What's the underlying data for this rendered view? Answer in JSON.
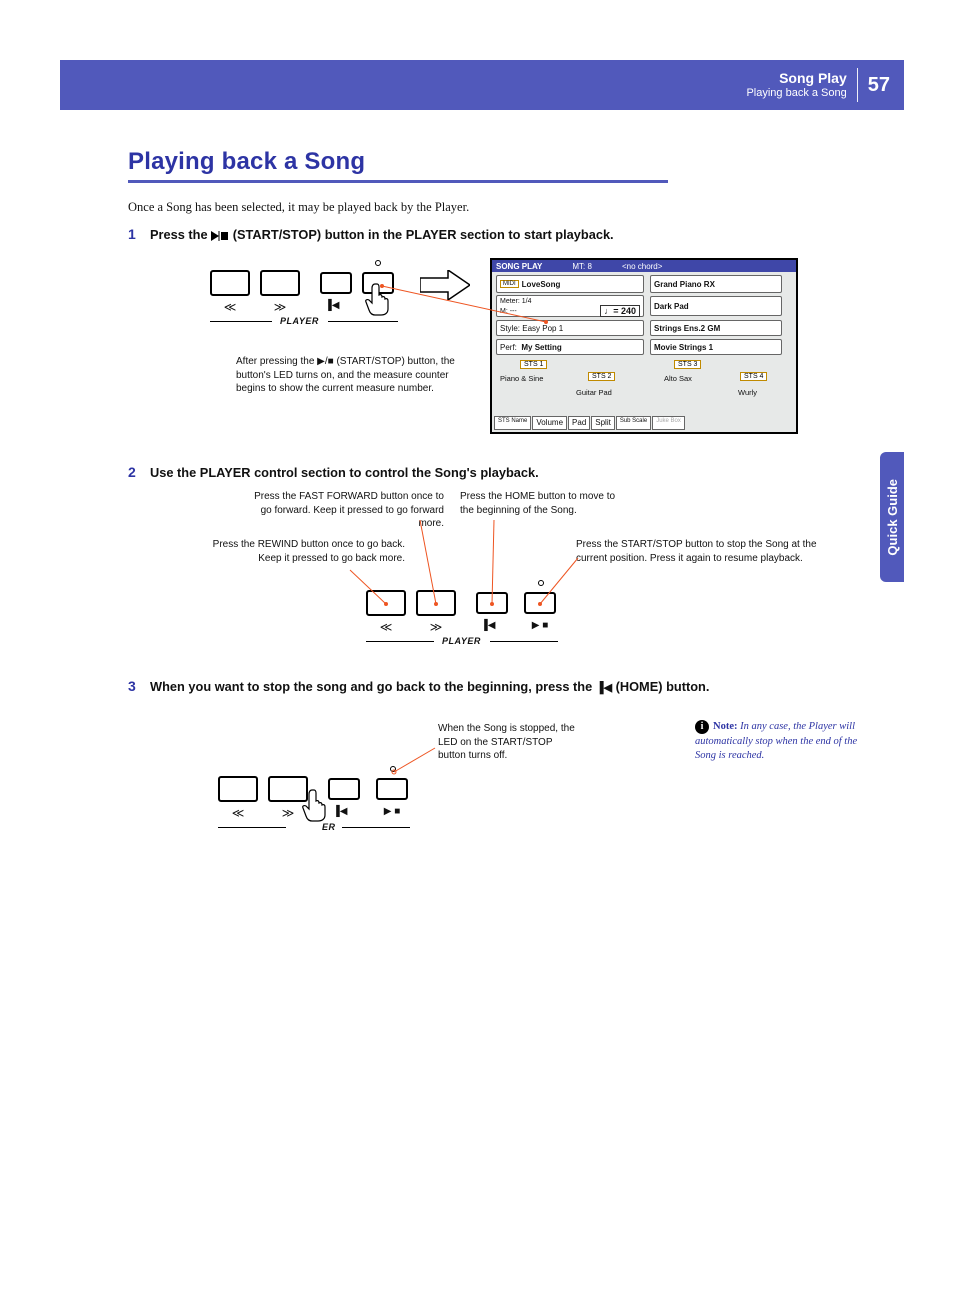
{
  "header": {
    "section": "Song Play",
    "subsection": "Playing back a Song",
    "page": "57"
  },
  "sidetab": "Quick Guide",
  "title": "Playing back a Song",
  "intro": "Once a Song has been selected, it may be played back by the Player.",
  "steps": {
    "s1": {
      "num": "1",
      "text_a": "Press the ",
      "text_b": " (START/STOP) button in the PLAYER section to start playback."
    },
    "s2": {
      "num": "2",
      "text": "Use the PLAYER control section to control the Song's playback."
    },
    "s3": {
      "num": "3",
      "text_a": "When you want to stop the song and go back to the beginning, press the ",
      "text_b": " (HOME) button."
    }
  },
  "captions": {
    "c1": "After pressing the ▶/■ (START/STOP) button, the button's LED turns on, and the measure counter begins to show the current measure number.",
    "ff": "Press the FAST FORWARD button once to go forward. Keep it pressed to go forward more.",
    "home": "Press the HOME button to move to the beginning of the Song.",
    "rew": "Press the REWIND button once to go back. Keep it pressed to go back more.",
    "ss": "Press the START/STOP button to stop the Song at the current position. Press it again to resume playback.",
    "ledoff": "When the Song is stopped, the LED on the START/STOP button turns off."
  },
  "player_label": "PLAYER",
  "symbols": {
    "rew": "≪",
    "ff": "≫",
    "home": "▐◀",
    "playstop": "▶ ■"
  },
  "lcd": {
    "title": "SONG PLAY",
    "mt": "MT: 8",
    "chord": "<no chord>",
    "song": "LoveSong",
    "songtype": "MIDI",
    "meter_label": "Meter: 1/4",
    "measure": "M: ---",
    "tempo": "♩= 240",
    "style_label": "Style:",
    "style": "Easy Pop 1",
    "perf_label": "Perf:",
    "perf": "My Setting",
    "up1": "Grand Piano RX",
    "up2": "Dark Pad",
    "up3": "Strings Ens.2 GM",
    "low": "Movie Strings 1",
    "sts1": "STS 1",
    "sts1_name": "Piano & Sine",
    "sts2": "STS 2",
    "sts2_name": "Guitar Pad",
    "sts3": "STS 3",
    "sts3_name": "Alto Sax",
    "sts4": "STS 4",
    "sts4_name": "Wurly",
    "bottom": [
      "STS Name",
      "Volume",
      "Pad",
      "Split",
      "Sub Scale",
      "Juke Box"
    ]
  },
  "note": {
    "label": "Note:",
    "text": "In any case, the Player will automatically stop when the end of the Song is reached."
  }
}
